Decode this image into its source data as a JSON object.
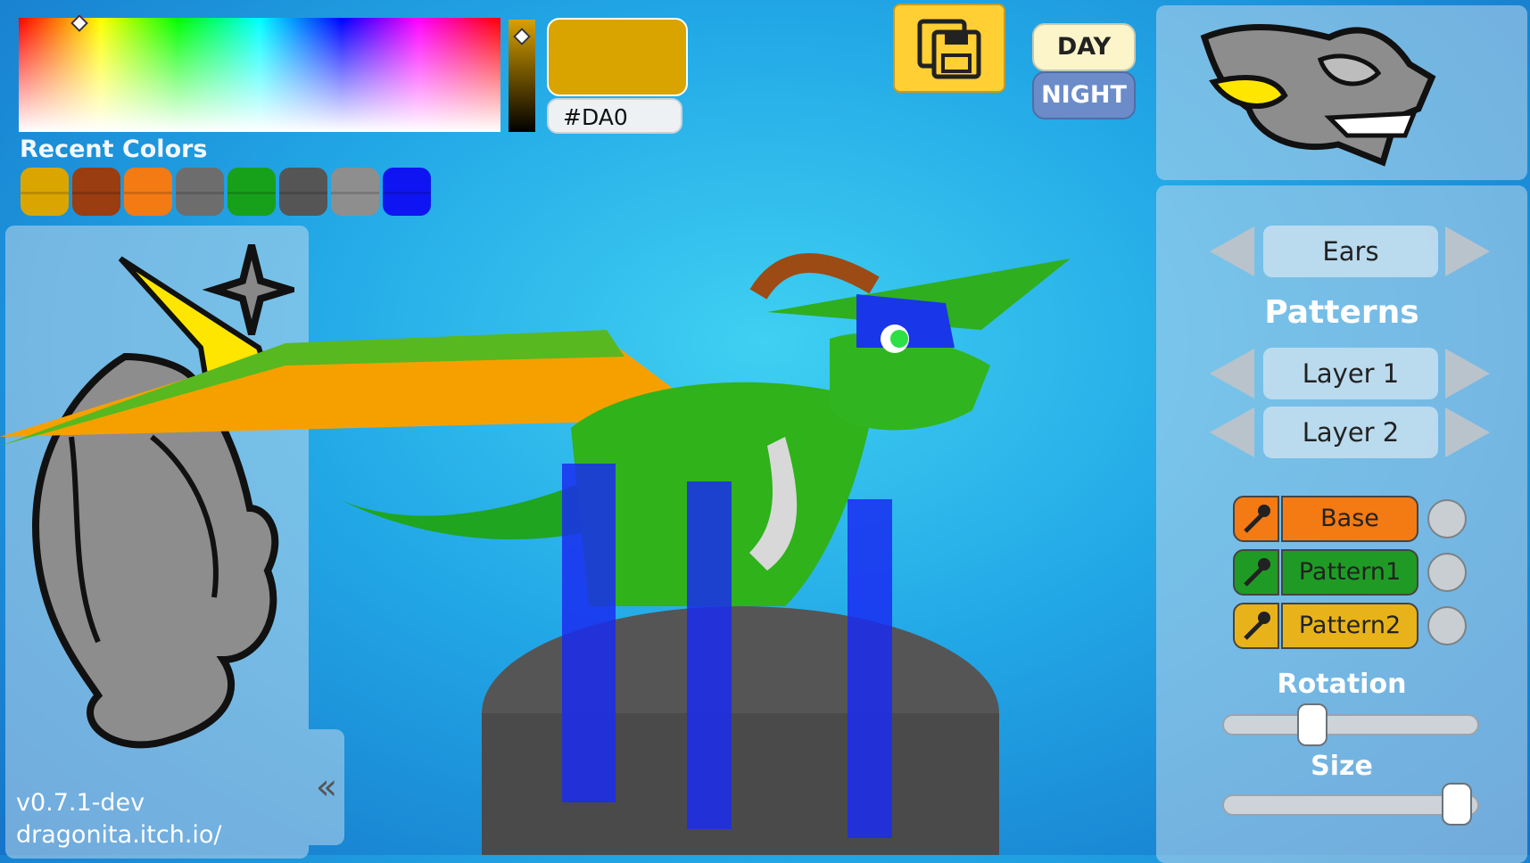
{
  "picker": {
    "hex": "#DA0",
    "current_color": "#d9a300"
  },
  "recent": {
    "title": "Recent Colors",
    "colors": [
      "#dba500",
      "#9a3d10",
      "#f47a14",
      "#6d6d6d",
      "#17a11a",
      "#555555",
      "#8e8e8e",
      "#0f14f2"
    ]
  },
  "toolbar": {
    "day_label": "DAY",
    "night_label": "NIGHT"
  },
  "version": "v0.7.1-dev",
  "site": "dragonita.itch.io/",
  "parts": {
    "selected": "Ears"
  },
  "patterns": {
    "title": "Patterns",
    "layer1": "Layer 1",
    "layer2": "Layer 2"
  },
  "colors": [
    {
      "label": "Base",
      "color": "#f47a14"
    },
    {
      "label": "Pattern1",
      "color": "#1f9b25"
    },
    {
      "label": "Pattern2",
      "color": "#e8b31a"
    }
  ],
  "rotation": {
    "label": "Rotation",
    "value": 0.33
  },
  "size": {
    "label": "Size",
    "value": 0.97
  }
}
